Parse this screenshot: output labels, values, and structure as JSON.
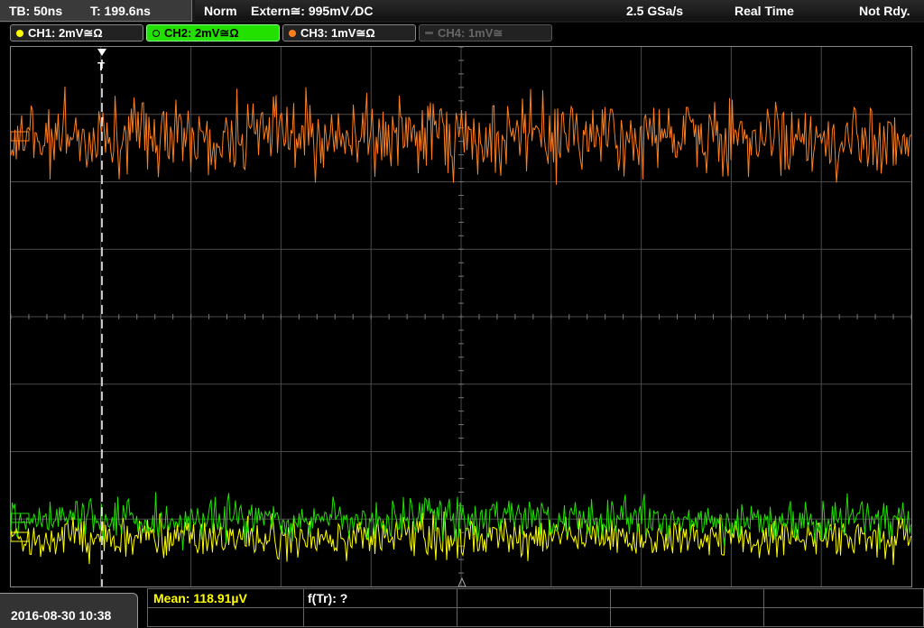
{
  "timebase": {
    "tb": "TB: 50ns",
    "trig_time": "T: 199.6ns"
  },
  "status": {
    "mode": "Norm",
    "source": "Extern≅: 995mV ∕DC",
    "sample_rate": "2.5 GSa/s",
    "acq_mode": "Real Time",
    "state": "Not Rdy."
  },
  "channels": [
    {
      "label": "CH1: 2mV≅Ω",
      "color": "#ffff00",
      "state": "on"
    },
    {
      "label": "CH2: 2mV≅Ω",
      "color": "#22e000",
      "state": "selected"
    },
    {
      "label": "CH3: 1mV≅Ω",
      "color": "#ff7f1e",
      "state": "on"
    },
    {
      "label": "CH4: 1mV≅",
      "color": "#666666",
      "state": "off"
    }
  ],
  "trigger_marker": "T",
  "measurements": {
    "mean": "Mean: 118.91µV",
    "freq": "f(Tr): ?"
  },
  "datetime": "2016-08-30 10:38",
  "colors": {
    "grid": "#4a4a4a",
    "ch1": "#ffff00",
    "ch2": "#22e000",
    "ch3": "#ff7f1e"
  }
}
